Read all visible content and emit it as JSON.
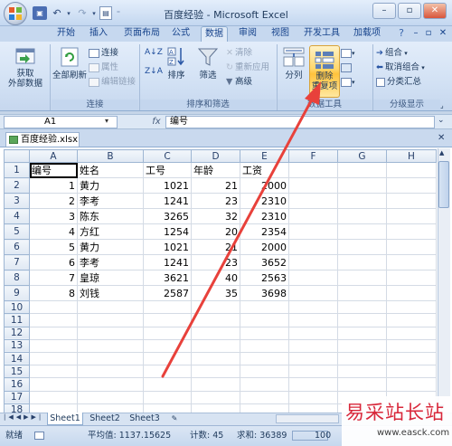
{
  "window": {
    "title": "百度经验 - Microsoft Excel",
    "minimize": "–",
    "restore": "▫",
    "close": "✕"
  },
  "tabs": [
    {
      "label": "开始",
      "active": false
    },
    {
      "label": "插入",
      "active": false
    },
    {
      "label": "页面布局",
      "active": false
    },
    {
      "label": "公式",
      "active": false
    },
    {
      "label": "数据",
      "active": true
    },
    {
      "label": "审阅",
      "active": false
    },
    {
      "label": "视图",
      "active": false
    },
    {
      "label": "开发工具",
      "active": false
    },
    {
      "label": "加载项",
      "active": false
    }
  ],
  "ribbon": {
    "get_external": {
      "line1": "获取",
      "line2": "外部数据"
    },
    "refresh_all": "全部刷新",
    "connections": "连接",
    "properties": "属性",
    "edit_links": "编辑链接",
    "group_connections": "连接",
    "sort_asc": "A↓Z",
    "sort_desc": "Z↓A",
    "sort": "排序",
    "filter": "筛选",
    "clear": "清除",
    "reapply": "重新应用",
    "advanced": "高级",
    "group_sort_filter": "排序和筛选",
    "text_to_columns": "分列",
    "remove_duplicates": {
      "line1": "删除",
      "line2": "重复项"
    },
    "group_data_tools": "数据工具",
    "group": "组合",
    "ungroup": "取消组合",
    "subtotal": "分类汇总",
    "group_outline": "分级显示"
  },
  "formula_bar": {
    "name_box": "A1",
    "fx": "fx",
    "content": "编号"
  },
  "workbook": {
    "filename": "百度经验.xlsx"
  },
  "columns": [
    "A",
    "B",
    "C",
    "D",
    "E",
    "F",
    "G",
    "H"
  ],
  "rows": [
    [
      "编号",
      "姓名",
      "工号",
      "年龄",
      "工资",
      "",
      "",
      ""
    ],
    [
      "1",
      "黄力",
      "1021",
      "21",
      "2000",
      "",
      "",
      ""
    ],
    [
      "2",
      "李考",
      "1241",
      "23",
      "2310",
      "",
      "",
      ""
    ],
    [
      "3",
      "陈东",
      "3265",
      "32",
      "2310",
      "",
      "",
      ""
    ],
    [
      "4",
      "方红",
      "1254",
      "20",
      "2354",
      "",
      "",
      ""
    ],
    [
      "5",
      "黄力",
      "1021",
      "21",
      "2000",
      "",
      "",
      ""
    ],
    [
      "6",
      "李考",
      "1241",
      "23",
      "3652",
      "",
      "",
      ""
    ],
    [
      "7",
      "皇琼",
      "3621",
      "40",
      "2563",
      "",
      "",
      ""
    ],
    [
      "8",
      "刘钱",
      "2587",
      "35",
      "3698",
      "",
      "",
      ""
    ],
    [
      "",
      "",
      "",
      "",
      "",
      "",
      "",
      ""
    ],
    [
      "",
      "",
      "",
      "",
      "",
      "",
      "",
      ""
    ],
    [
      "",
      "",
      "",
      "",
      "",
      "",
      "",
      ""
    ],
    [
      "",
      "",
      "",
      "",
      "",
      "",
      "",
      ""
    ],
    [
      "",
      "",
      "",
      "",
      "",
      "",
      "",
      ""
    ],
    [
      "",
      "",
      "",
      "",
      "",
      "",
      "",
      ""
    ],
    [
      "",
      "",
      "",
      "",
      "",
      "",
      "",
      ""
    ],
    [
      "",
      "",
      "",
      "",
      "",
      "",
      "",
      ""
    ],
    [
      "",
      "",
      "",
      "",
      "",
      "",
      "",
      ""
    ],
    [
      "",
      "",
      "",
      "",
      "",
      "",
      "",
      ""
    ],
    [
      "",
      "",
      "",
      "",
      "",
      "",
      "",
      ""
    ]
  ],
  "sheets": [
    {
      "label": "Sheet1",
      "active": true
    },
    {
      "label": "Sheet2",
      "active": false
    },
    {
      "label": "Sheet3",
      "active": false
    }
  ],
  "status": {
    "ready": "就绪",
    "average": "平均值: 1137.15625",
    "count": "计数: 45",
    "sum": "求和: 36389",
    "zoom": "100"
  },
  "watermark": {
    "text": "易采站长站",
    "url": "www.easck.com"
  },
  "colors": {
    "arrow": "#e8413b",
    "accent": "#ffc23c",
    "watermark": "#d8273a"
  }
}
